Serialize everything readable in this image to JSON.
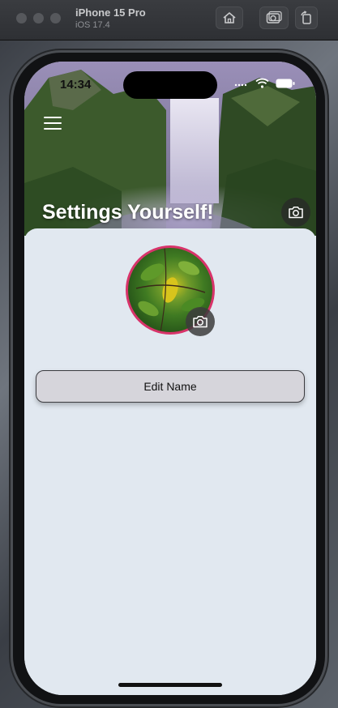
{
  "simulator": {
    "device_name": "iPhone 15 Pro",
    "os_version": "iOS 17.4"
  },
  "status_bar": {
    "time": "14:34"
  },
  "header": {
    "title": "Settings Yourself!"
  },
  "profile": {
    "edit_name_label": "Edit Name"
  },
  "colors": {
    "avatar_border": "#d8336a",
    "content_background": "#e1e8f0",
    "button_background": "#d6d5db"
  },
  "icons": {
    "menu": "hamburger-icon",
    "cover_camera": "camera-icon",
    "avatar_camera": "camera-icon",
    "wifi": "wifi-icon",
    "battery": "battery-icon"
  }
}
